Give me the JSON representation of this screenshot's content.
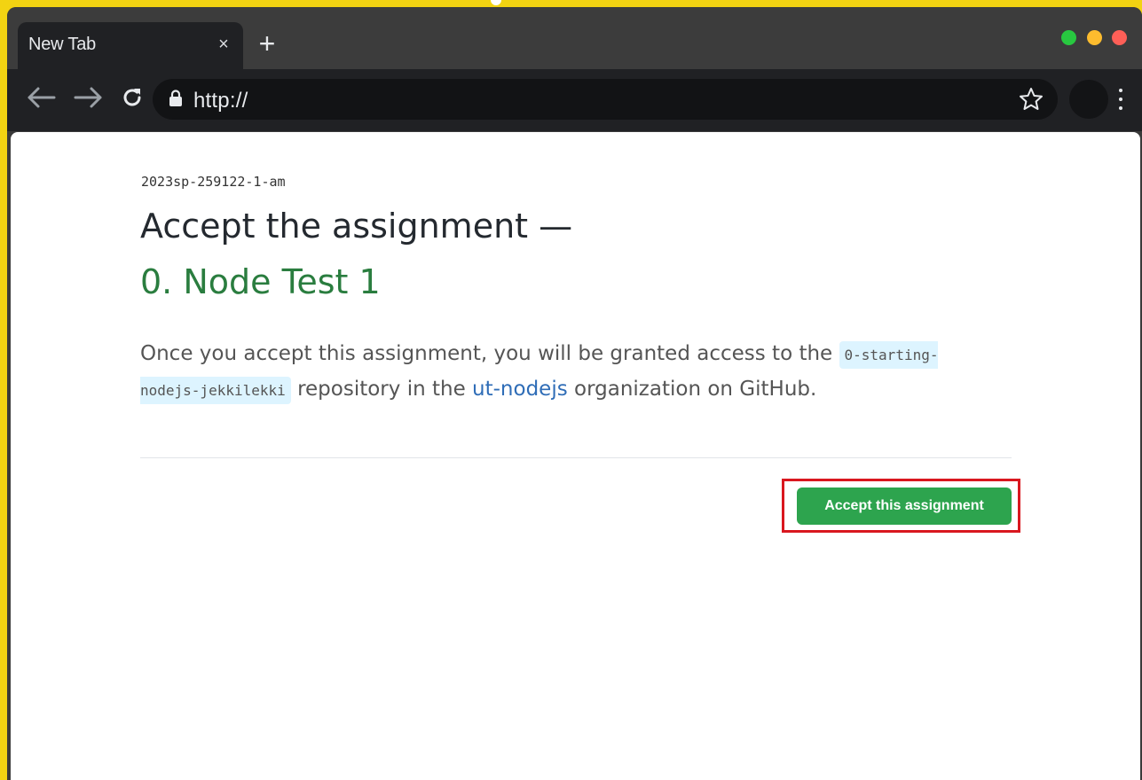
{
  "browser": {
    "tab_title": "New Tab",
    "tab_close": "×",
    "new_tab": "+",
    "url": "http://",
    "window_controls": [
      {
        "name": "zoom",
        "color": "#28c840"
      },
      {
        "name": "minimize",
        "color": "#fdbc2e"
      },
      {
        "name": "close",
        "color": "#fe5f57"
      }
    ],
    "icons": [
      "back-arrow-icon",
      "forward-arrow-icon",
      "reload-icon",
      "lock-icon",
      "star-icon",
      "menu-icon"
    ]
  },
  "page": {
    "org_code": "2023sp-259122-1-am",
    "heading": "Accept the assignment —",
    "assignment_name": "0. Node Test 1",
    "description": {
      "part1": "Once you accept this assignment, you will be granted access to the ",
      "repo_name": "0-starting-nodejs-jekkilekki",
      "part2": " repository in the ",
      "org_link": "ut-nodejs",
      "part3": " organization on GitHub."
    },
    "accept_button": "Accept this assignment"
  },
  "colors": {
    "accent_green": "#2da44e",
    "title_green": "#2a7d3f",
    "link_blue": "#2f6db7",
    "highlight_red": "#d9171f",
    "frame_yellow": "#f2d312"
  }
}
